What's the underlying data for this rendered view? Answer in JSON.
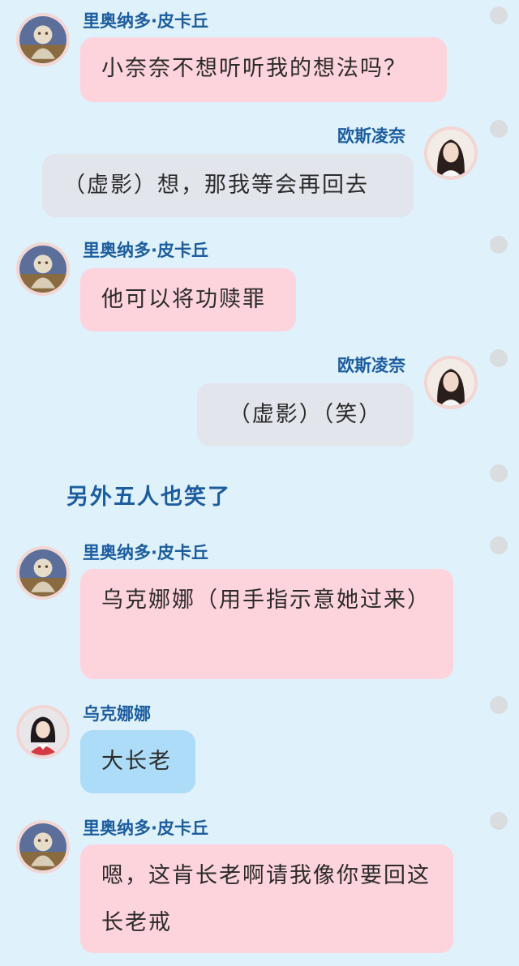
{
  "characters": {
    "pikachu": "里奥纳多·皮卡丘",
    "aosi": "欧斯凌奈",
    "uk": "乌克娜娜"
  },
  "messages": [
    {
      "text": "小奈奈不想听听我的想法吗？"
    },
    {
      "text": "（虚影）想，那我等会再回去"
    },
    {
      "text": "他可以将功赎罪"
    },
    {
      "text": "（虚影）（笑）"
    },
    {
      "text": "另外五人也笑了"
    },
    {
      "text": "乌克娜娜（用手指示意她过来）"
    },
    {
      "text": "大长老"
    },
    {
      "text": "嗯，这肯长老啊请我像你要回这长老戒"
    }
  ],
  "colors": {
    "background": "#dff1fb",
    "name": "#1d5d9e",
    "bubble_pink": "#fdd3dc",
    "bubble_gray": "#e2e6ec",
    "bubble_blue": "#acdcf7"
  },
  "icons": {
    "avatar_pikachu": "elder-statue-avatar",
    "avatar_aosi": "girl-portrait-avatar",
    "avatar_uk": "girl-red-dress-avatar",
    "menu_dot": "gray-dot-icon"
  }
}
